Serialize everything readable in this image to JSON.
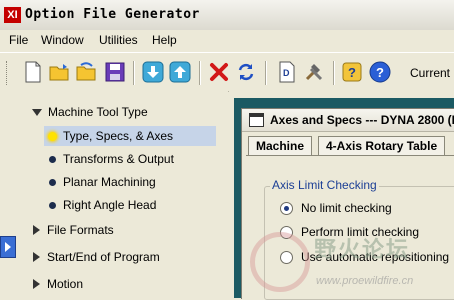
{
  "app": {
    "logo_text": "XI",
    "title": "Option File Generator"
  },
  "menu": [
    {
      "label": "File"
    },
    {
      "label": "Window"
    },
    {
      "label": "Utilities"
    },
    {
      "label": "Help"
    }
  ],
  "toolbar": {
    "current_label": "Current"
  },
  "tree": {
    "items": [
      {
        "label": "Machine Tool Type",
        "expander": "down"
      },
      {
        "label": "Type, Specs, & Axes",
        "selected": true
      },
      {
        "label": "Transforms & Output"
      },
      {
        "label": "Planar Machining"
      },
      {
        "label": "Right Angle Head"
      },
      {
        "label": "File Formats",
        "expander": "right"
      },
      {
        "label": "Start/End of Program",
        "expander": "right"
      },
      {
        "label": "Motion",
        "expander": "right"
      }
    ]
  },
  "internal_window": {
    "title": "Axes and Specs --- DYNA 2800 (D",
    "tabs": [
      {
        "label": "Machine"
      },
      {
        "label": "4-Axis Rotary Table"
      }
    ],
    "group": {
      "title": "Axis Limit Checking",
      "options": [
        {
          "label": "No limit checking",
          "checked": true
        },
        {
          "label": "Perform limit checking",
          "checked": false
        },
        {
          "label": "Use automatic repositioning",
          "checked": false
        }
      ]
    }
  },
  "watermark": {
    "text": "野火论坛",
    "url": "www.proewildfire.cn"
  }
}
